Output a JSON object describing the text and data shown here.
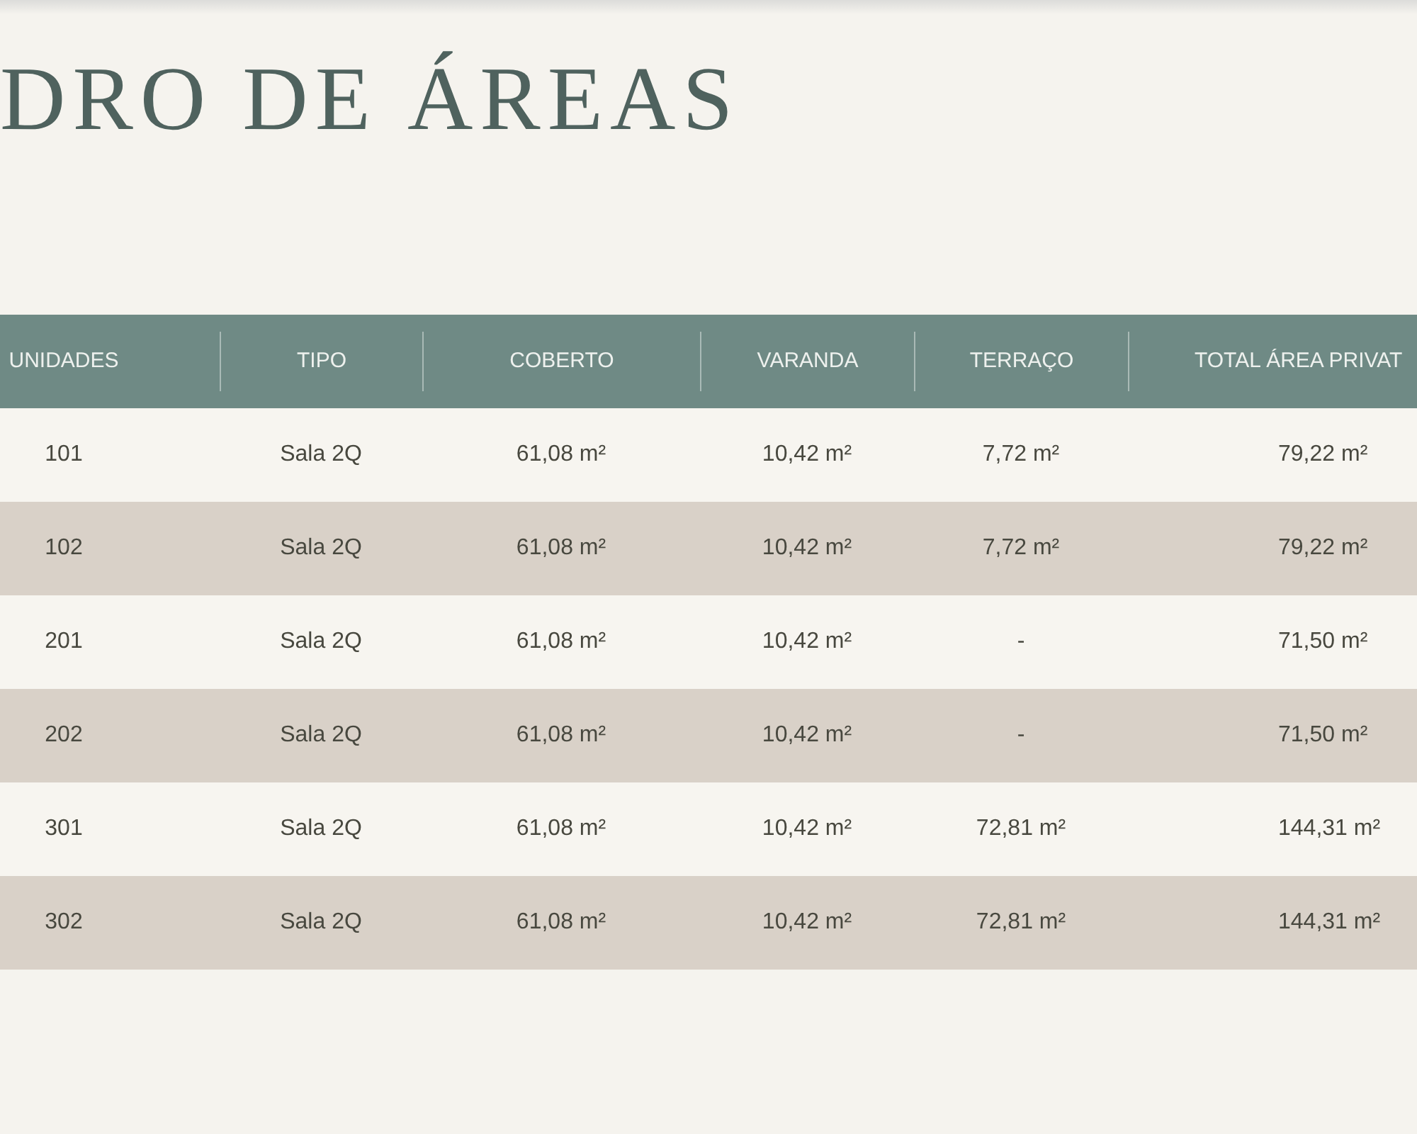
{
  "title": "DRO DE ÁREAS",
  "table": {
    "columns": [
      "UNIDADES",
      "TIPO",
      "COBERTO",
      "VARANDA",
      "TERRAÇO",
      "TOTAL ÁREA PRIVAT"
    ],
    "rows": [
      [
        "101",
        "Sala 2Q",
        "61,08 m²",
        "10,42 m²",
        "7,72 m²",
        "79,22 m²"
      ],
      [
        "102",
        "Sala 2Q",
        "61,08 m²",
        "10,42 m²",
        "7,72 m²",
        "79,22 m²"
      ],
      [
        "201",
        "Sala 2Q",
        "61,08 m²",
        "10,42 m²",
        "-",
        "71,50 m²"
      ],
      [
        "202",
        "Sala 2Q",
        "61,08 m²",
        "10,42 m²",
        "-",
        "71,50 m²"
      ],
      [
        "301",
        "Sala 2Q",
        "61,08 m²",
        "10,42 m²",
        "72,81 m²",
        "144,31 m²"
      ],
      [
        "302",
        "Sala 2Q",
        "61,08 m²",
        "10,42 m²",
        "72,81 m²",
        "144,31 m²"
      ]
    ]
  }
}
